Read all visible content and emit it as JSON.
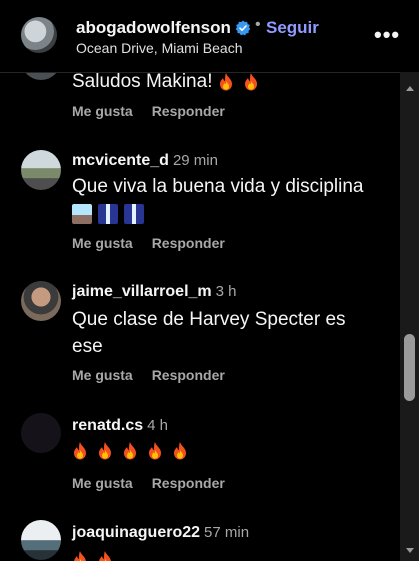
{
  "header": {
    "username": "abogadowolfenson",
    "follow_label": "Seguir",
    "separator": "•",
    "location": "Ocean Drive, Miami Beach",
    "more_label": "•••"
  },
  "actions": {
    "like_label": "Me gusta",
    "reply_label": "Responder"
  },
  "comments": [
    {
      "username": "",
      "time": "",
      "text": "Saludos Makina! "
    },
    {
      "username": "mcvicente_d",
      "time": "29 min",
      "text": "Que viva la buena vida y disciplina"
    },
    {
      "username": "jaime_villarroel_m",
      "time": "3 h",
      "text": "Que clase de Harvey Specter es ese"
    },
    {
      "username": "renatd.cs",
      "time": "4 h",
      "text": ""
    },
    {
      "username": "joaquinaguero22",
      "time": "57 min",
      "text": ""
    }
  ],
  "icons": {
    "verified": "verified-badge-icon",
    "flame": "fire-emoji-icon",
    "more": "more-options-icon"
  },
  "colors": {
    "accent": "#8e9bff",
    "verified": "#3897f0",
    "background": "#000000"
  }
}
